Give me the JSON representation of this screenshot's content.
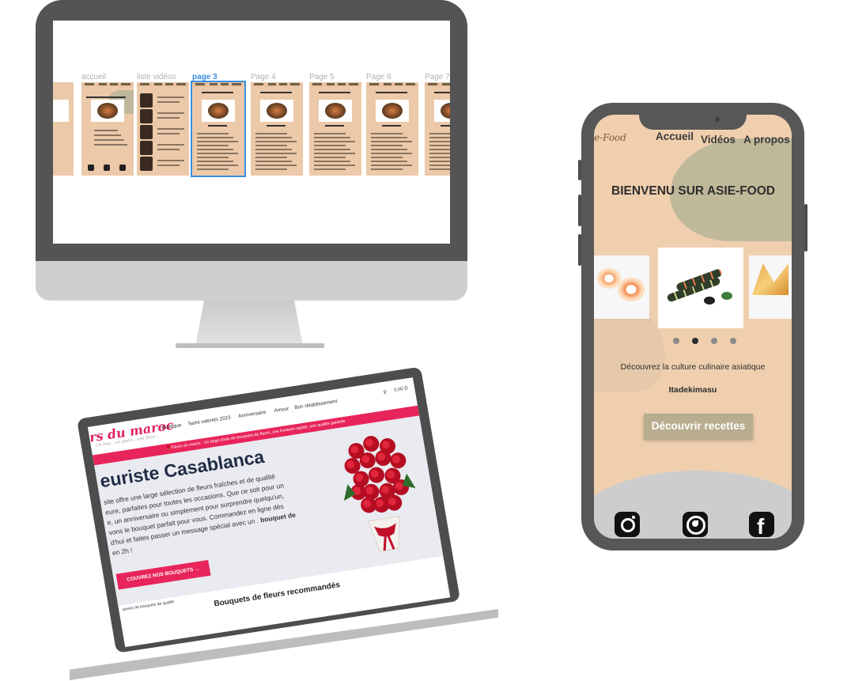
{
  "desktop": {
    "frames": [
      {
        "label": "accueil",
        "active": false
      },
      {
        "label": "liste vidéos",
        "active": false
      },
      {
        "label": "page 3",
        "active": true
      },
      {
        "label": "Page 4",
        "active": false
      },
      {
        "label": "Page 5",
        "active": false
      },
      {
        "label": "Page 6",
        "active": false
      },
      {
        "label": "Page 7",
        "active": false
      }
    ]
  },
  "phone": {
    "logo": "e-Food",
    "nav": [
      "Accueil",
      "Vidéos",
      "A propos"
    ],
    "title": "BIENVENU SUR ASIE-FOOD",
    "carousel_dots": 4,
    "carousel_active": 1,
    "tagline": "Découvrez la culture culinaire asiatique",
    "subtitle": "Itadekimasu",
    "cta": "Découvrir recettes",
    "social": [
      "instagram-icon",
      "whatsapp-icon",
      "facebook-icon"
    ]
  },
  "laptop": {
    "logo": "rs du maroc",
    "logo_sub": "Un mot... un geste... une fleur...",
    "nav": [
      "Boutique",
      "Saint valentin 2023",
      "Anniversaire",
      "Amour",
      "Bon rétablissement"
    ],
    "cart": "0,00 D",
    "banner": "🌹Fleurs du maroc : Un large choix de bouquets de fleurs, une livraison rapide, une qualité garantie",
    "hero_title": "euriste Casablanca",
    "hero_text_1": "site offre une large sélection de fleurs fraîches et de qualité",
    "hero_text_2": "eure, parfaites pour toutes les occasions. Que ce soit pour un",
    "hero_text_3": "e, un anniversaire ou simplement pour surprendre quelqu'un,",
    "hero_text_4": "vons le bouquet parfait pour vous. Commandez en ligne dès",
    "hero_text_5": "d'hui et faites passer un message spécial avec un .",
    "hero_text_bold": "bouquet de",
    "hero_text_6": "en 2h !",
    "cta": "COUVREZ NOS BOUQUETS →",
    "express": "xpress de bouquets de qualité",
    "section_title": "Bouquets de fleurs recommandés"
  },
  "colors": {
    "phone_bg": "#efcfae",
    "phone_accent": "#bfb99a",
    "laptop_brand": "#e8255b",
    "selection_blue": "#3a8fe6"
  }
}
